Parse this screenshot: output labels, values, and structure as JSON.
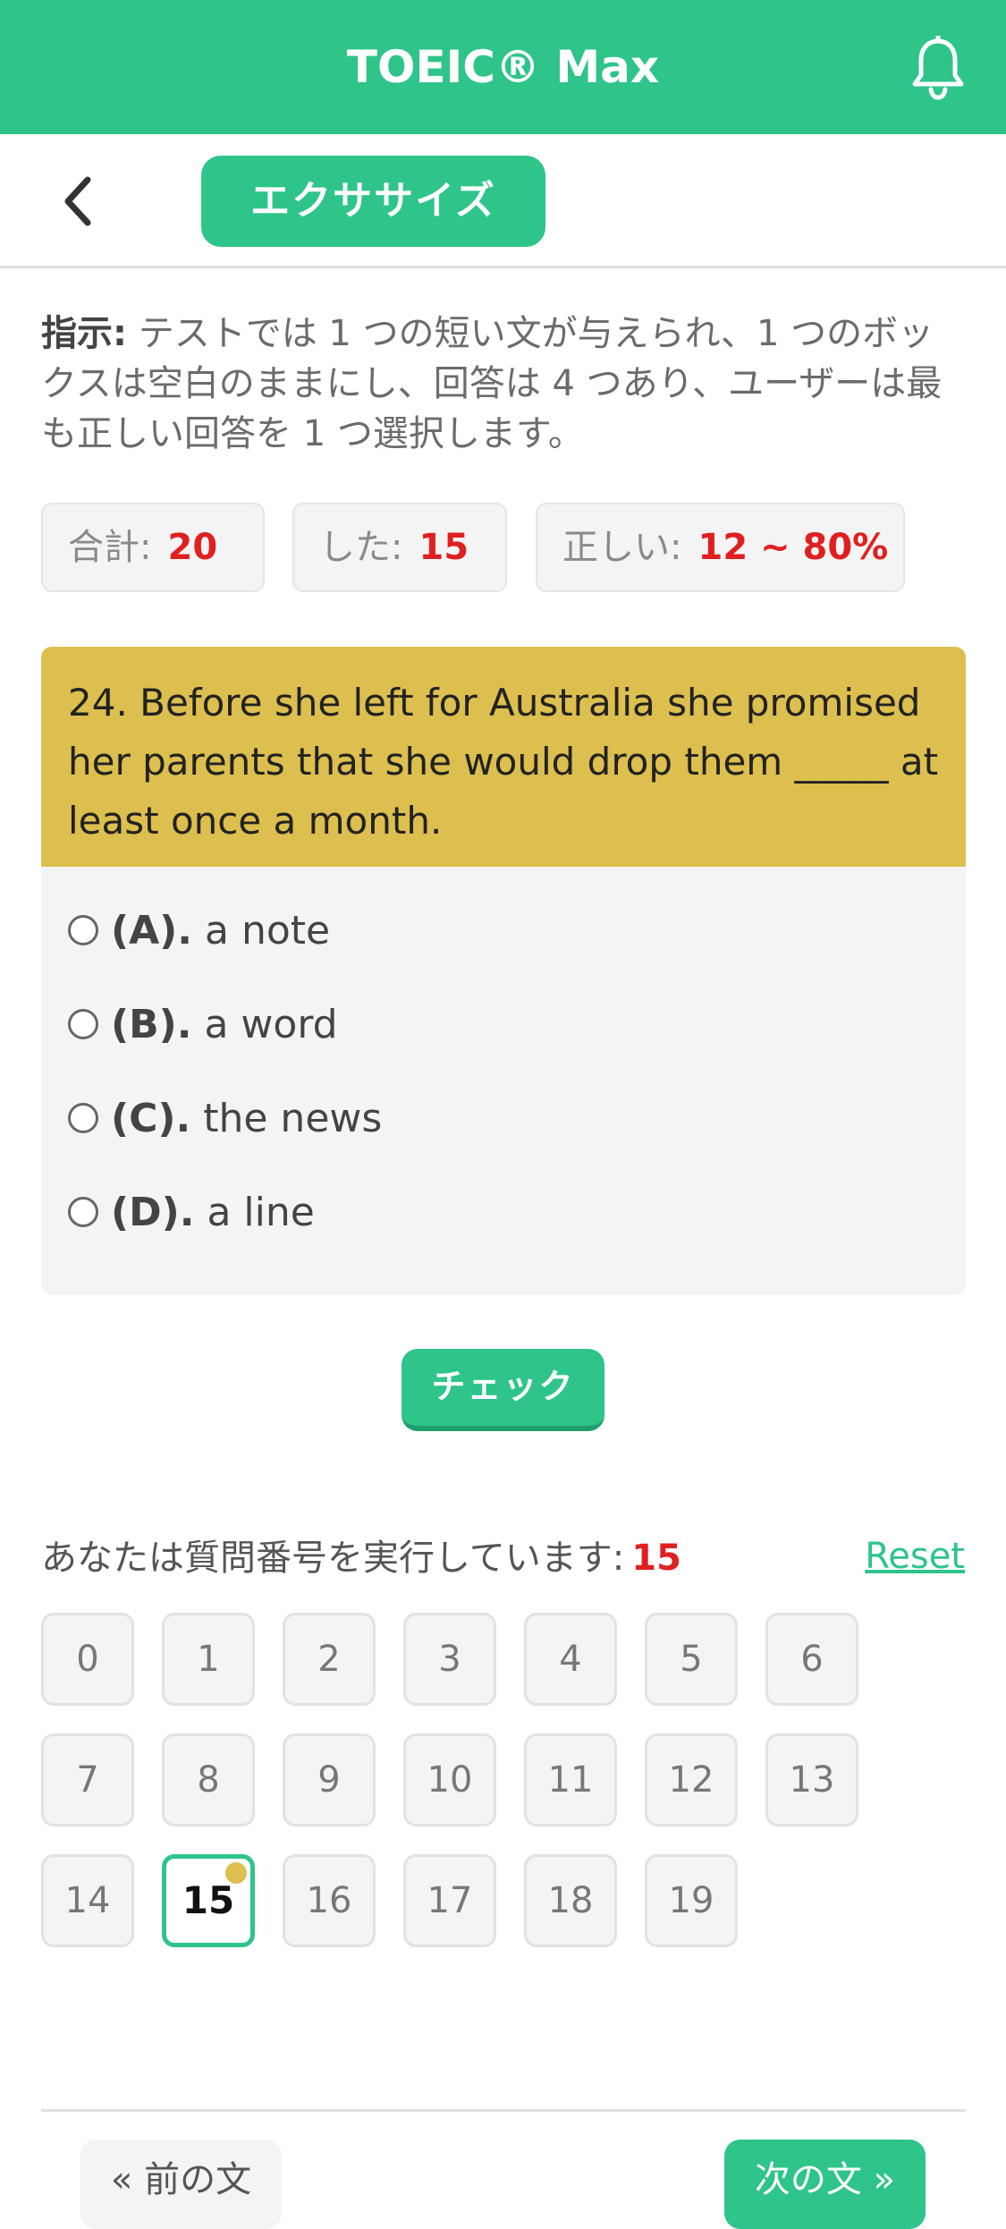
{
  "app": {
    "title": "TOEIC® Max",
    "icons": {
      "notifications": "bell-icon",
      "back": "chevron-left-icon"
    }
  },
  "header": {
    "tab_label": "エクササイズ"
  },
  "instructions": {
    "label": "指示:",
    "text": " テストでは 1 つの短い文が与えられ、1 つのボックスは空白のままにし、回答は 4 つあり、ユーザーは最も正しい回答を 1 つ選択します。"
  },
  "stats": {
    "total_label": "合計:",
    "total_value": "20",
    "done_label": "した:",
    "done_value": "15",
    "correct_label": "正しい:",
    "correct_value": "12 ~ 80%"
  },
  "question": {
    "text": "24. Before she left for Australia she promised her parents that she would drop them _____ at least once a month.",
    "options": [
      {
        "letter": "(A).",
        "text": "a note"
      },
      {
        "letter": "(B).",
        "text": "a word"
      },
      {
        "letter": "(C).",
        "text": "the news"
      },
      {
        "letter": "(D).",
        "text": "a line"
      }
    ]
  },
  "actions": {
    "check_label": "チェック",
    "reset_label": "Reset",
    "prev_label": "« 前の文",
    "next_label": "次の文 »"
  },
  "progress": {
    "label": "あなたは質問番号を実行しています:",
    "current": "15",
    "numbers": [
      "0",
      "1",
      "2",
      "3",
      "4",
      "5",
      "6",
      "7",
      "8",
      "9",
      "10",
      "11",
      "12",
      "13",
      "14",
      "15",
      "16",
      "17",
      "18",
      "19"
    ],
    "active_index": 15
  },
  "colors": {
    "brand": "#2ec48a",
    "question_bg": "#dcbf4e",
    "highlight": "#e02020"
  }
}
